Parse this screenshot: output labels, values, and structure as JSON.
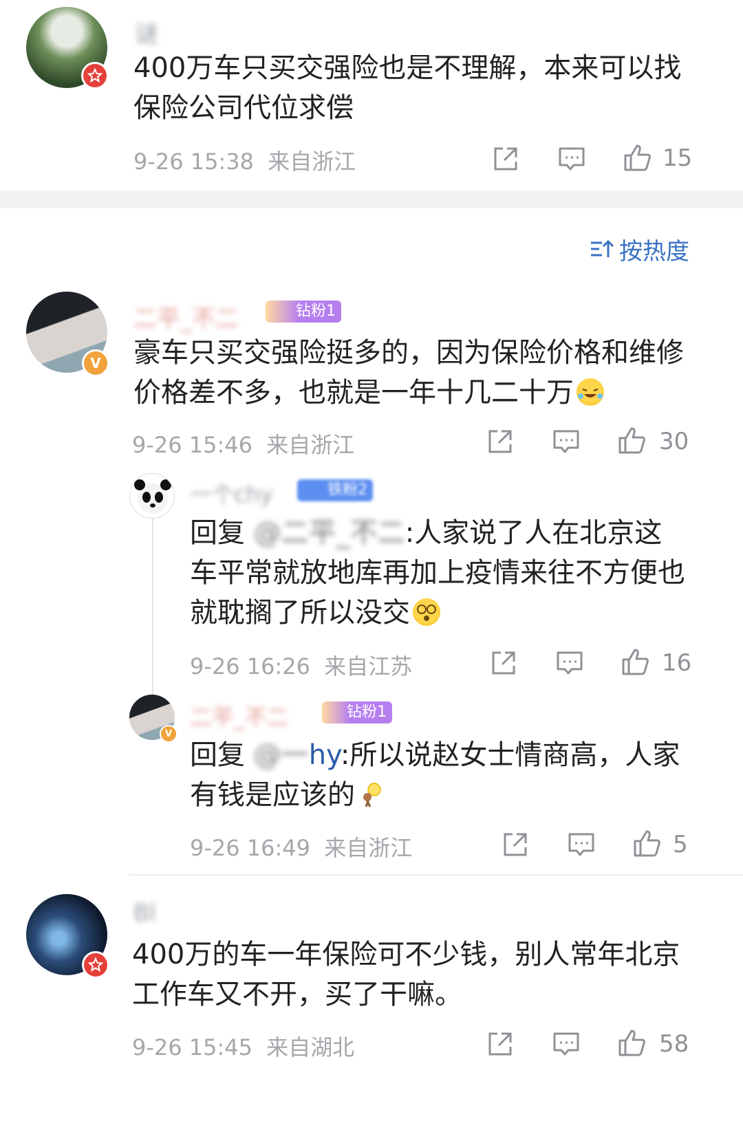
{
  "comments": [
    {
      "name": "谜",
      "text": "400万车只买交强险也是不理解，本来可以找保险公司代位求偿",
      "time": "9-26 15:38",
      "location": "来自浙江",
      "likes": "15"
    },
    {
      "name": "二平_不二",
      "fan_badge": "钻粉1",
      "text": "豪车只买交强险挺多的，因为保险价格和维修价格差不多，也就是一年十几二十万",
      "time": "9-26 15:46",
      "location": "来自浙江",
      "likes": "30"
    },
    {
      "name": "Bl",
      "text": "400万的车一年保险可不少钱，别人常年北京工作车又不开，买了干嘛。",
      "time": "9-26 15:45",
      "location": "来自湖北",
      "likes": "58"
    }
  ],
  "replies": [
    {
      "name": "一个chy",
      "fan_badge": "铁粉2",
      "reply_prefix": "回复",
      "mention": "@二平_不二",
      "text": ":人家说了人在北京这车平常就放地库再加上疫情来往不方便也就耽搁了所以没交",
      "time": "9-26 16:26",
      "location": "来自江苏",
      "likes": "16"
    },
    {
      "name": "二平_不二",
      "fan_badge": "钻粉1",
      "reply_prefix": "回复",
      "mention": "@一",
      "mention_tail": "hy",
      "text": ":所以说赵女士情商高，人家有钱是应该的",
      "time": "9-26 16:49",
      "location": "来自浙江",
      "likes": "5"
    }
  ],
  "sort": {
    "label": "按热度"
  },
  "colors": {
    "accent": "#3a72c4",
    "divider_band": "#f2f2f2",
    "vip_badge": "#f1a23a",
    "red_badge": "#e5403a",
    "fan_badge": "#b67ff0"
  },
  "icons": [
    "share-icon",
    "comment-icon",
    "like-icon",
    "sort-icon",
    "laugh-cry-emoji",
    "dizzy-emoji",
    "lightbulb-emoji"
  ]
}
